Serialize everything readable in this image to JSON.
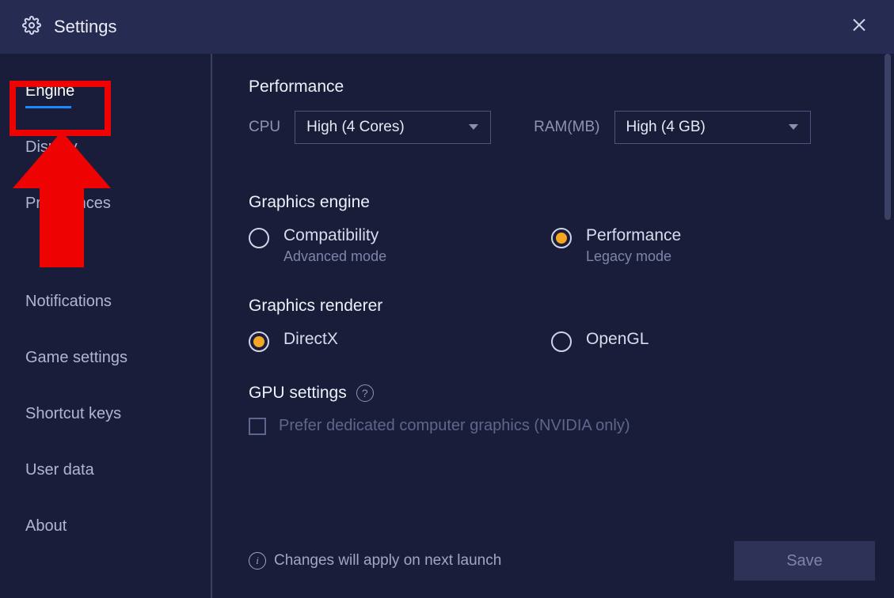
{
  "header": {
    "title": "Settings"
  },
  "sidebar": {
    "items": [
      {
        "label": "Engine",
        "active": true
      },
      {
        "label": "Display",
        "active": false
      },
      {
        "label": "Preferences",
        "active": false
      },
      {
        "label": "",
        "active": false
      },
      {
        "label": "Notifications",
        "active": false
      },
      {
        "label": "Game settings",
        "active": false
      },
      {
        "label": "Shortcut keys",
        "active": false
      },
      {
        "label": "User data",
        "active": false
      },
      {
        "label": "About",
        "active": false
      }
    ]
  },
  "performance": {
    "title": "Performance",
    "cpu_label": "CPU",
    "cpu_value": "High (4 Cores)",
    "ram_label": "RAM(MB)",
    "ram_value": "High (4 GB)"
  },
  "graphics_engine": {
    "title": "Graphics engine",
    "options": [
      {
        "label": "Compatibility",
        "sub": "Advanced mode",
        "checked": false
      },
      {
        "label": "Performance",
        "sub": "Legacy mode",
        "checked": true
      }
    ]
  },
  "graphics_renderer": {
    "title": "Graphics renderer",
    "options": [
      {
        "label": "DirectX",
        "checked": true
      },
      {
        "label": "OpenGL",
        "checked": false
      }
    ]
  },
  "gpu": {
    "title": "GPU settings",
    "checkbox_label": "Prefer dedicated computer graphics (NVIDIA only)",
    "checkbox_checked": false
  },
  "footer": {
    "note": "Changes will apply on next launch",
    "save_label": "Save"
  },
  "annotation": {
    "highlight_target": "sidebar-item-engine",
    "arrow_color": "#ee0202"
  }
}
